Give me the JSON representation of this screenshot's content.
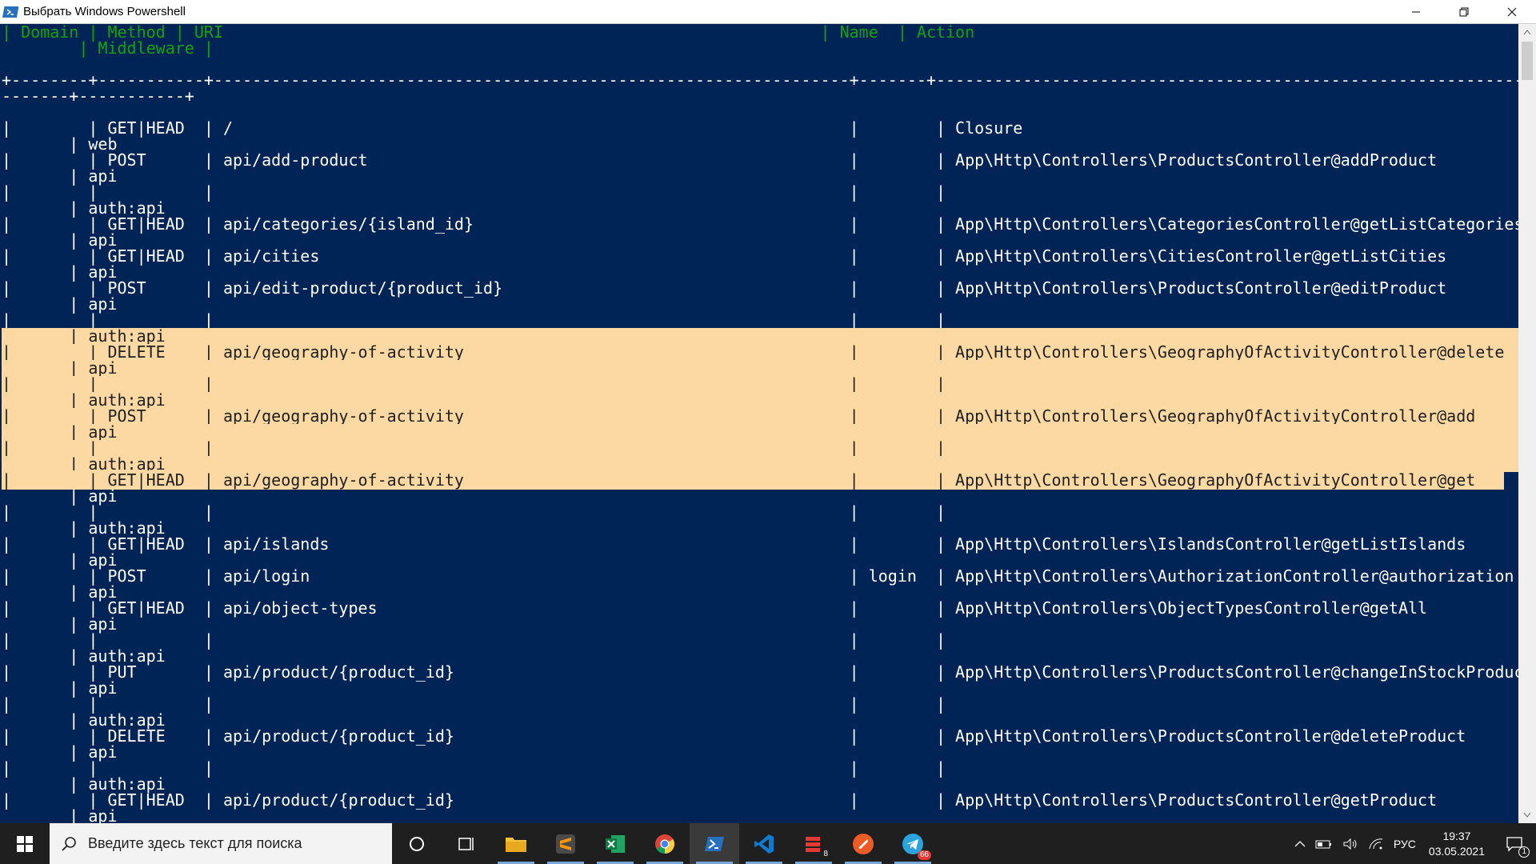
{
  "window": {
    "title": "Выбрать Windows Powershell"
  },
  "console": {
    "header_line_1": "| Domain | Method | URI                                                              | Name  | Action",
    "header_line_2": "        | Middleware |",
    "separator_1": "+--------+-----------+------------------------------------------------------------------+-------+-----------------------------------------------------------------------------------------------------------------------",
    "separator_2": "-------+-----------+",
    "rows": [
      {
        "method": "GET|HEAD",
        "uri": "/",
        "name": "",
        "action": "Closure",
        "middleware": "web",
        "auth": false
      },
      {
        "method": "POST",
        "uri": "api/add-product",
        "name": "",
        "action": "App\\Http\\Controllers\\ProductsController@addProduct",
        "middleware": "api",
        "auth": true
      },
      {
        "method": "GET|HEAD",
        "uri": "api/categories/{island_id}",
        "name": "",
        "action": "App\\Http\\Controllers\\CategoriesController@getListCategories",
        "middleware": "api",
        "auth": false
      },
      {
        "method": "GET|HEAD",
        "uri": "api/cities",
        "name": "",
        "action": "App\\Http\\Controllers\\CitiesController@getListCities",
        "middleware": "api",
        "auth": false
      },
      {
        "method": "POST",
        "uri": "api/edit-product/{product_id}",
        "name": "",
        "action": "App\\Http\\Controllers\\ProductsController@editProduct",
        "middleware": "api",
        "auth": true
      },
      {
        "method": "DELETE",
        "uri": "api/geography-of-activity",
        "name": "",
        "action": "App\\Http\\Controllers\\GeographyOfActivityController@delete",
        "middleware": "api",
        "auth": true
      },
      {
        "method": "POST",
        "uri": "api/geography-of-activity",
        "name": "",
        "action": "App\\Http\\Controllers\\GeographyOfActivityController@add",
        "middleware": "api",
        "auth": true
      },
      {
        "method": "GET|HEAD",
        "uri": "api/geography-of-activity",
        "name": "",
        "action": "App\\Http\\Controllers\\GeographyOfActivityController@get",
        "middleware": "api",
        "auth": true
      },
      {
        "method": "GET|HEAD",
        "uri": "api/islands",
        "name": "",
        "action": "App\\Http\\Controllers\\IslandsController@getListIslands",
        "middleware": "api",
        "auth": false
      },
      {
        "method": "POST",
        "uri": "api/login",
        "name": "login",
        "action": "App\\Http\\Controllers\\AuthorizationController@authorization",
        "middleware": "api",
        "auth": false
      },
      {
        "method": "GET|HEAD",
        "uri": "api/object-types",
        "name": "",
        "action": "App\\Http\\Controllers\\ObjectTypesController@getAll",
        "middleware": "api",
        "auth": true
      },
      {
        "method": "PUT",
        "uri": "api/product/{product_id}",
        "name": "",
        "action": "App\\Http\\Controllers\\ProductsController@changeInStockProduct",
        "middleware": "api",
        "auth": true
      },
      {
        "method": "DELETE",
        "uri": "api/product/{product_id}",
        "name": "",
        "action": "App\\Http\\Controllers\\ProductsController@deleteProduct",
        "middleware": "api",
        "auth": true
      },
      {
        "method": "GET|HEAD",
        "uri": "api/product/{product_id}",
        "name": "",
        "action": "App\\Http\\Controllers\\ProductsController@getProduct",
        "middleware": "api",
        "auth": true
      }
    ],
    "auth_label": "auth:api",
    "selection_rows": [
      5,
      6,
      7
    ]
  },
  "taskbar": {
    "search_placeholder": "Введите здесь текст для поиска",
    "apps": [
      "task-view",
      "file-explorer",
      "sublime-text",
      "excel",
      "chrome",
      "powershell",
      "vscode",
      "app-red",
      "postman",
      "telegram"
    ],
    "badge_app_red": "8",
    "badge_telegram": "66",
    "lang": "РУС",
    "time": "19:37",
    "date": "03.05.2021",
    "notifications_count": "1"
  },
  "colors": {
    "console_bg": "#012456",
    "header_text": "#13a10e",
    "selection_bg": "#fcd9a3"
  }
}
